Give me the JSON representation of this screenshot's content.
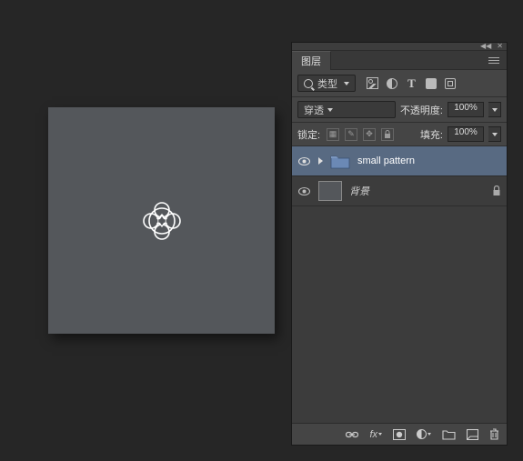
{
  "panel": {
    "tab_label": "图层",
    "filter_label": "类型",
    "blend_mode_label": "穿透",
    "opacity_label": "不透明度:",
    "opacity_value": "100%",
    "lock_label": "锁定:",
    "fill_label": "填充:",
    "fill_value": "100%"
  },
  "layers": [
    {
      "name": "small pattern",
      "visible": true,
      "type": "folder",
      "selected": true,
      "locked": false
    },
    {
      "name": "背景",
      "visible": true,
      "type": "pixel",
      "selected": false,
      "locked": true,
      "italic": true
    }
  ],
  "topstrip": {
    "collapse": "◀◀",
    "close": "✕"
  }
}
